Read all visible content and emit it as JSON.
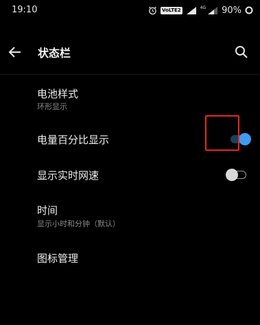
{
  "status_bar": {
    "time": "19:10",
    "volte_label": "VoLTE2",
    "network_type": "4G",
    "battery_percent": "90%",
    "icons": [
      "alarm-icon",
      "signal-icon",
      "signal-icon",
      "battery-icon"
    ]
  },
  "toolbar": {
    "back_icon": "arrow-left",
    "title": "状态栏",
    "search_icon": "magnifier"
  },
  "settings": {
    "battery_style": {
      "title": "电池样式",
      "subtitle": "环形显示"
    },
    "battery_percentage": {
      "title": "电量百分比显示",
      "enabled": true
    },
    "realtime_speed": {
      "title": "显示实时网速",
      "enabled": false
    },
    "time": {
      "title": "时间",
      "subtitle": "显示小时和分钟（默认）"
    },
    "icon_management": {
      "title": "图标管理"
    }
  },
  "colors": {
    "background": "#000000",
    "accent": "#3f9bf0",
    "highlight": "#e8271f"
  }
}
